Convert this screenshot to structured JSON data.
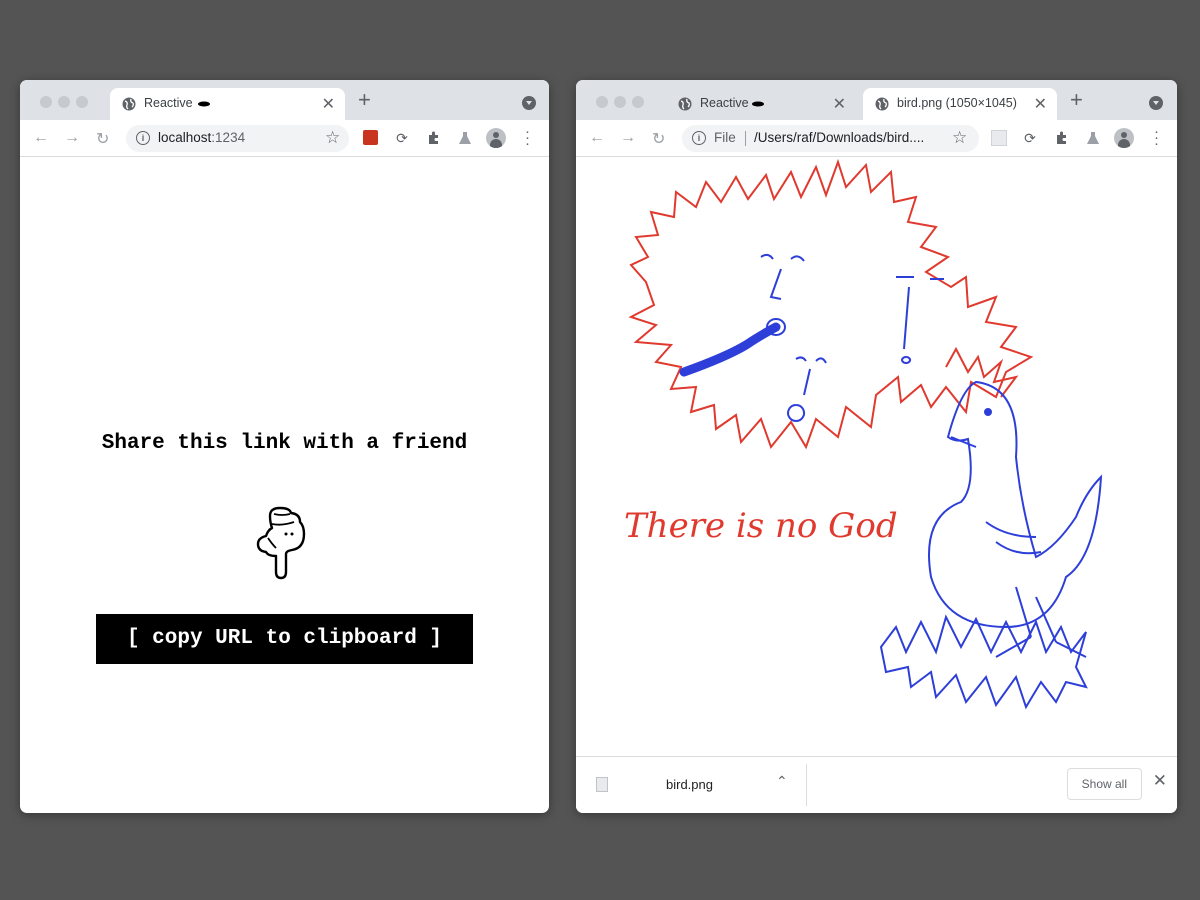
{
  "left_window": {
    "tab": {
      "title": "Reactive"
    },
    "address": {
      "host": "localhost",
      "port": ":1234"
    },
    "page": {
      "heading": "Share this link with a friend",
      "button_label": "[ copy URL to clipboard ]"
    }
  },
  "right_window": {
    "tabs": [
      {
        "title": "Reactive"
      },
      {
        "title": "bird.png (1050×1045)"
      }
    ],
    "address": {
      "scheme_label": "File",
      "path": "/Users/raf/Downloads/bird...."
    },
    "image": {
      "handwritten_text": "There is no God"
    },
    "downloads": {
      "file_name": "bird.png",
      "show_all_label": "Show all"
    }
  },
  "colors": {
    "desktop_bg": "#545454",
    "tabstrip_bg": "#dee1e6",
    "drawing_red": "#e03a2f",
    "drawing_blue": "#2d3fd8",
    "button_bg": "#000000"
  },
  "icons": [
    "globe-icon",
    "close-icon",
    "plus-icon",
    "back-arrow-icon",
    "forward-arrow-icon",
    "reload-icon",
    "info-icon",
    "star-icon",
    "extensions-puzzle-icon",
    "flask-icon",
    "avatar-icon",
    "kebab-menu-icon",
    "pointing-hand-icon",
    "chevron-up-icon"
  ]
}
